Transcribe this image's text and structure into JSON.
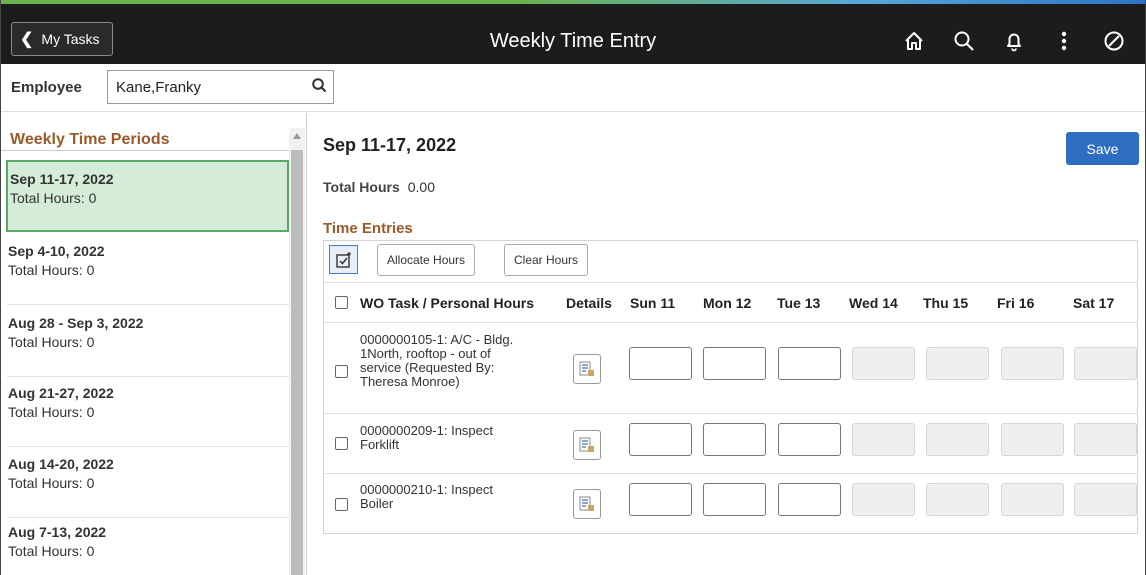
{
  "header": {
    "back_label": "My Tasks",
    "title": "Weekly Time Entry",
    "icons": [
      "home-icon",
      "search-icon",
      "bell-icon",
      "more-vertical-icon",
      "compass-icon"
    ]
  },
  "employee": {
    "label": "Employee",
    "value": "Kane,Franky"
  },
  "periods_panel": {
    "title": "Weekly Time Periods",
    "items": [
      {
        "name": "Sep 11-17, 2022",
        "hours": "Total Hours: 0",
        "selected": true
      },
      {
        "name": "Sep 4-10, 2022",
        "hours": "Total Hours: 0"
      },
      {
        "name": "Aug 28 - Sep 3, 2022",
        "hours": "Total Hours: 0"
      },
      {
        "name": "Aug 21-27, 2022",
        "hours": "Total Hours: 0"
      },
      {
        "name": "Aug 14-20, 2022",
        "hours": "Total Hours: 0"
      },
      {
        "name": "Aug 7-13, 2022",
        "hours": "Total Hours: 0"
      }
    ]
  },
  "main": {
    "period_title": "Sep 11-17, 2022",
    "save_label": "Save",
    "total_label": "Total Hours",
    "total_value": "0.00",
    "entries_title": "Time Entries",
    "toolbar": {
      "allocate_label": "Allocate Hours",
      "clear_label": "Clear Hours"
    },
    "columns": [
      "WO Task / Personal Hours",
      "Details",
      "Sun 11",
      "Mon 12",
      "Tue 13",
      "Wed 14",
      "Thu 15",
      "Fri 16",
      "Sat 17"
    ],
    "rows": [
      {
        "task": "0000000105-1: A/C - Bldg.\n1North, rooftop - out of\nservice        (Requested By:\nTheresa Monroe)"
      },
      {
        "task": "0000000209-1: Inspect\nForklift"
      },
      {
        "task": "0000000210-1: Inspect\nBoiler"
      }
    ]
  },
  "colors": {
    "topbar": "#1c1c1c",
    "save_button": "#2e6ec2",
    "section_title": "#9b5a2a",
    "selected_period_bg": "#d4ecd8",
    "selected_period_border": "#5aa867"
  }
}
